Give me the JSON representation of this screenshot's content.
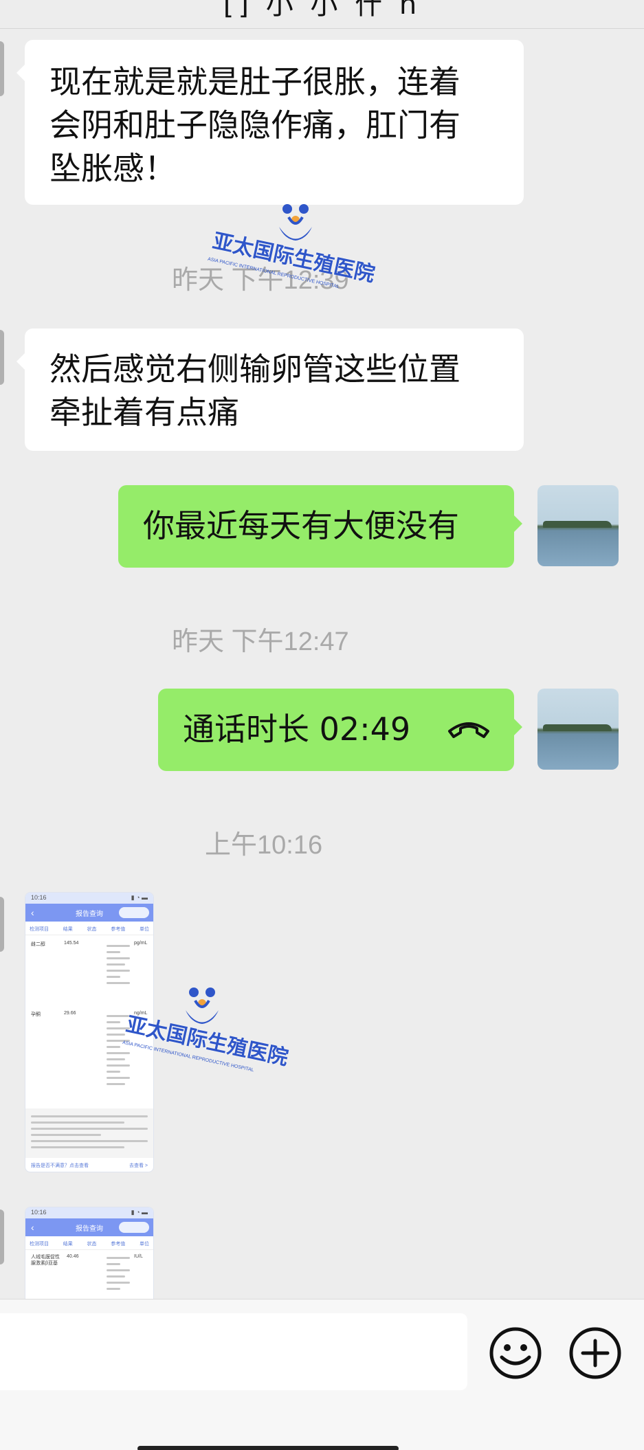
{
  "header": {
    "title": "[] 小 小 什 n"
  },
  "messages": {
    "m1": {
      "lines": [
        "现在就是就是肚子很胀，连着",
        "会阴和肚子隐隐作痛，肛门有",
        "坠胀感！"
      ]
    },
    "t1": {
      "label": "昨天 下午12:39"
    },
    "m2": {
      "lines": [
        "然后感觉右侧输卵管这些位置",
        "牵扯着有点痛"
      ]
    },
    "m3": {
      "text": "你最近每天有大便没有"
    },
    "t2": {
      "label": "昨天 下午12:47"
    },
    "m4": {
      "text": "通话时长 02:49"
    },
    "t3": {
      "label": "上午10:16"
    }
  },
  "report_image_1": {
    "status_time": "10:16",
    "title": "报告查询",
    "columns": [
      "检测项目",
      "结果",
      "状态",
      "参考值",
      "单位"
    ],
    "rows": [
      {
        "item": "雌二醇",
        "result": "145.54",
        "unit": "pg/mL"
      },
      {
        "item": "孕酮",
        "result": "29.66",
        "unit": "ng/mL"
      }
    ],
    "footer_link_left": "报告是否不满意？点击查看",
    "footer_link_right": "去查看 >"
  },
  "report_image_2": {
    "status_time": "10:16",
    "title": "报告查询",
    "columns": [
      "检测项目",
      "结果",
      "状态",
      "参考值",
      "单位"
    ],
    "row_item": "人绒毛膜促性腺激素β亚基",
    "row_result": "40.46",
    "row_unit": "IU/L"
  },
  "watermark": {
    "text": "亚太国际生殖医院",
    "sub": "ASIA PACIFIC INTERNATIONAL REPRODUCTIVE HOSPITAL"
  },
  "colors": {
    "incoming_bubble": "#ffffff",
    "outgoing_bubble": "#95ec69",
    "background": "#ededed",
    "timestamp": "#a9a9a9",
    "report_nav": "#7c97f2"
  },
  "icons": {
    "call": "phone-hangup-icon",
    "emoji": "smiley-icon",
    "plus": "plus-circle-icon"
  }
}
